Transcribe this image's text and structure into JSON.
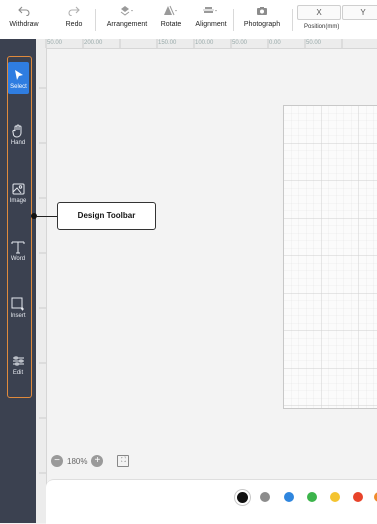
{
  "toolbar": {
    "withdraw": "Withdraw",
    "redo": "Redo",
    "arrangement": "Arrangement",
    "rotate": "Rotate",
    "alignment": "Alignment",
    "photograph": "Photograph",
    "position_x": "X",
    "position_y": "Y",
    "position_label": "Position(mm)"
  },
  "ruler": {
    "top_ticks": [
      "50.00",
      "200.00",
      "150.00",
      "100.00",
      "50.00",
      "0.00",
      "50.00"
    ]
  },
  "sidebar": {
    "tools": [
      {
        "label": "Select",
        "icon": "cursor-icon",
        "active": true
      },
      {
        "label": "Hand",
        "icon": "hand-icon",
        "active": false
      },
      {
        "label": "Image",
        "icon": "image-icon",
        "active": false
      },
      {
        "label": "Word",
        "icon": "text-icon",
        "active": false
      },
      {
        "label": "Insert",
        "icon": "shape-icon",
        "active": false
      },
      {
        "label": "Edit",
        "icon": "sliders-icon",
        "active": false
      }
    ]
  },
  "callout": {
    "label": "Design Toolbar"
  },
  "zoom": {
    "value": "180%"
  },
  "palette": {
    "colors": [
      "#111111",
      "#8c8c8c",
      "#2f86de",
      "#3cb44b",
      "#f4c430",
      "#e8432a",
      "#f08a2a"
    ],
    "selected_index": 0
  },
  "colors": {
    "sidebar": "#3b4150",
    "accent": "#2f7de1",
    "outline": "#e08a3c"
  }
}
